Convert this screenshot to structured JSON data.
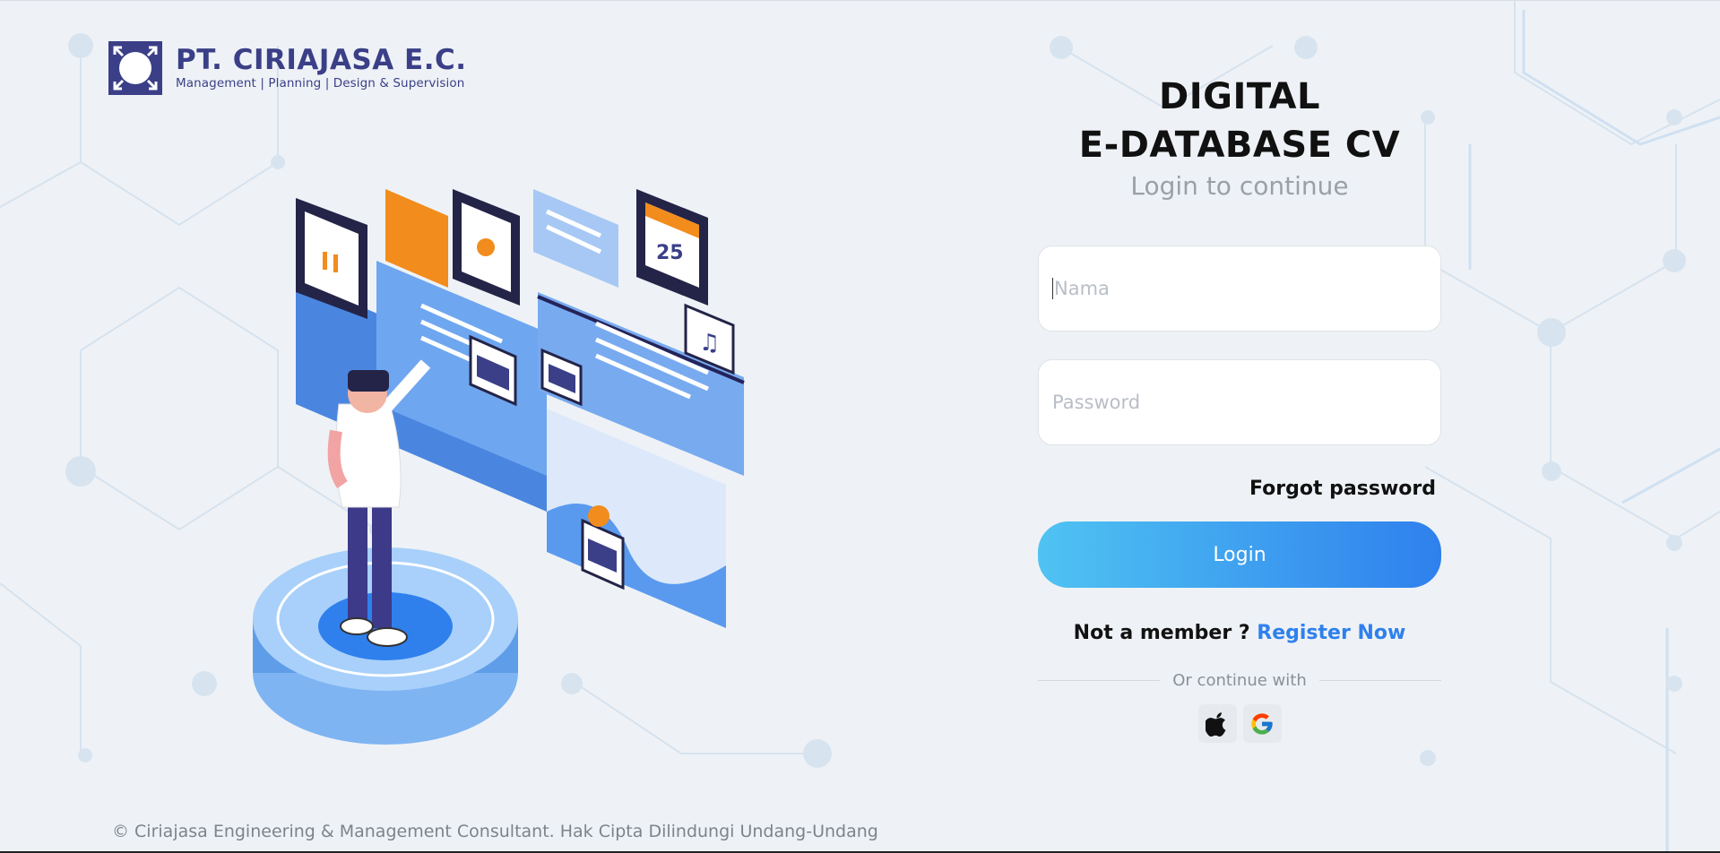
{
  "brand": {
    "name": "PT. CIRIAJASA E.C.",
    "tagline": "Management | Planning | Design & Supervision",
    "color": "#3a3f87"
  },
  "login": {
    "title_line1": "DIGITAL",
    "title_line2": "E-DATABASE CV",
    "subtitle": "Login to continue",
    "name_placeholder": "Nama",
    "password_placeholder": "Password",
    "forgot_label": "Forgot password",
    "login_label": "Login",
    "member_text": "Not a member ?",
    "register_label": "Register Now",
    "divider_text": "Or continue with"
  },
  "social": [
    {
      "name": "apple-icon"
    },
    {
      "name": "google-icon"
    }
  ],
  "illustration": {
    "calendar_day": "25"
  },
  "footer": {
    "copyright": "© Ciriajasa Engineering & Management Consultant. Hak Cipta Dilindungi Undang-Undang"
  },
  "colors": {
    "accent": "#2f80ed",
    "button_gradient_start": "#4fc3f2",
    "button_gradient_end": "#2f80ed",
    "background": "#eef2f6"
  }
}
